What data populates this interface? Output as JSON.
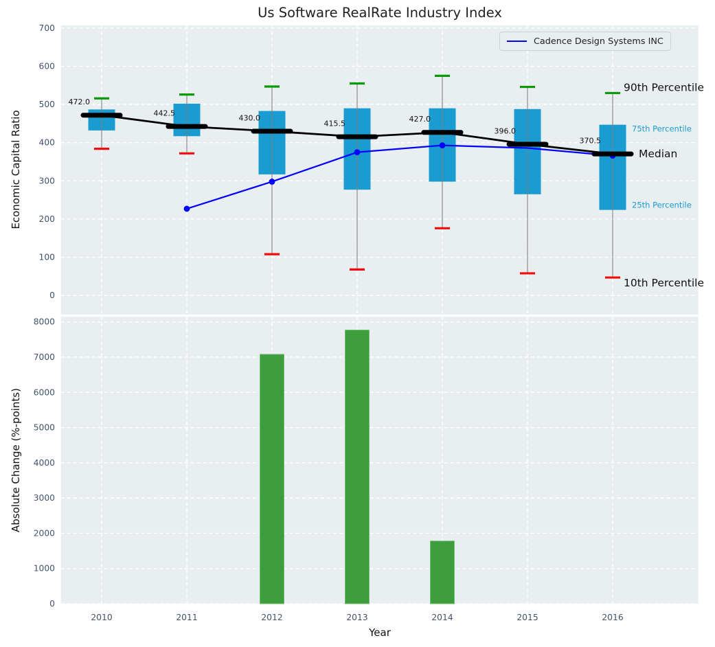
{
  "figure_title": "Us Software RealRate Industry Index",
  "colors": {
    "box": "#1a9cd0",
    "p90_cap": "#0a9a0a",
    "p10_cap": "#f20d0d",
    "median_line": "#000000",
    "company_line": "#0000ff",
    "bar": "#3d9d3d",
    "bar_edge": "#71bd71",
    "axes_bg": "#e9eef0",
    "grid": "#ffffff",
    "whisker": "#808080",
    "tick_label": "#42526b",
    "pct_label_blue": "#1a9cd0",
    "text_dark": "#111111"
  },
  "chart_data": [
    {
      "type": "box",
      "title": "Us Software RealRate Industry Index",
      "ylabel": "Economic Capital Ratio",
      "ylim": [
        -50,
        707
      ],
      "yticks": [
        0,
        100,
        200,
        300,
        400,
        500,
        600,
        700
      ],
      "grid": true,
      "legend": [
        "Cadence Design Systems INC"
      ],
      "legend_position": "upper right",
      "categories": [
        "2010",
        "2011",
        "2012",
        "2013",
        "2014",
        "2015",
        "2016"
      ],
      "series": [
        {
          "name": "90th Percentile",
          "values": [
            516,
            526,
            547,
            555,
            575,
            546,
            530
          ]
        },
        {
          "name": "75th Percentile",
          "values": [
            487,
            502,
            483,
            490,
            490,
            488,
            447
          ]
        },
        {
          "name": "Median",
          "values": [
            472.0,
            442.5,
            430.0,
            415.5,
            427.0,
            396.0,
            370.5
          ]
        },
        {
          "name": "25th Percentile",
          "values": [
            432,
            417,
            317,
            277,
            298,
            265,
            224
          ]
        },
        {
          "name": "10th Percentile",
          "values": [
            384,
            372,
            108,
            68,
            176,
            58,
            47
          ]
        },
        {
          "name": "Cadence Design Systems INC",
          "values": [
            null,
            227,
            298,
            375,
            393,
            386,
            366
          ],
          "markers": [
            false,
            true,
            true,
            true,
            true,
            false,
            true
          ]
        }
      ],
      "median_labels": [
        "472.0",
        "442.5",
        "430.0",
        "415.5",
        "427.0",
        "396.0",
        "370.5"
      ],
      "right_annotations": [
        {
          "label": "90th Percentile",
          "style": "big"
        },
        {
          "label": "75th Percentile",
          "style": "small-blue"
        },
        {
          "label": "Median",
          "style": "big"
        },
        {
          "label": "25th Percentile",
          "style": "small-blue"
        },
        {
          "label": "10th Percentile",
          "style": "big"
        }
      ]
    },
    {
      "type": "bar",
      "xlabel": "Year",
      "ylabel": "Absolute Change (%-points)",
      "ylim": [
        0,
        8150
      ],
      "yticks": [
        0,
        1000,
        2000,
        3000,
        4000,
        5000,
        6000,
        7000,
        8000
      ],
      "grid": true,
      "categories": [
        "2010",
        "2011",
        "2012",
        "2013",
        "2014",
        "2015",
        "2016"
      ],
      "values": [
        null,
        null,
        7080,
        7770,
        1780,
        null,
        null
      ]
    }
  ]
}
